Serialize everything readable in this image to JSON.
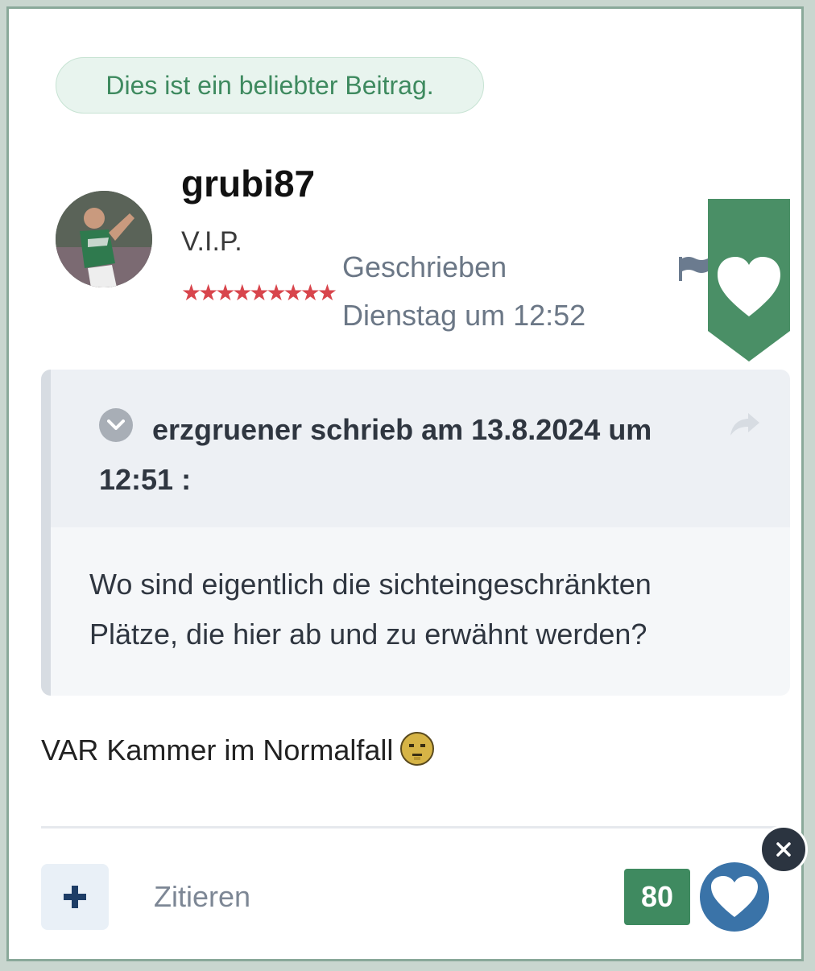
{
  "post": {
    "popular_badge": "Dies ist ein beliebter Beitrag.",
    "author": {
      "username": "grubi87",
      "rank": "V.I.P.",
      "stars": "★★★★★★★★★"
    },
    "written_label": "Geschrieben",
    "written_date": "Dienstag um 12:52",
    "quote": {
      "author_line": "erzgruener schrieb am 13.8.2024 um 12:51 :",
      "body": "Wo sind eigentlich die sichteingeschränkten Plätze, die hier ab und zu erwähnt werden?"
    },
    "text": "VAR Kammer im Normalfall",
    "footer": {
      "quote_label": "Zitieren",
      "like_count": "80"
    }
  },
  "colors": {
    "accent_green": "#4a8f66",
    "like_blue": "#3a73a8",
    "badge_text": "#3e8a5f"
  },
  "icons": [
    "flag-icon",
    "heart-icon",
    "chevron-down-icon",
    "share-icon",
    "emoji-icon",
    "plus-icon",
    "close-icon"
  ]
}
